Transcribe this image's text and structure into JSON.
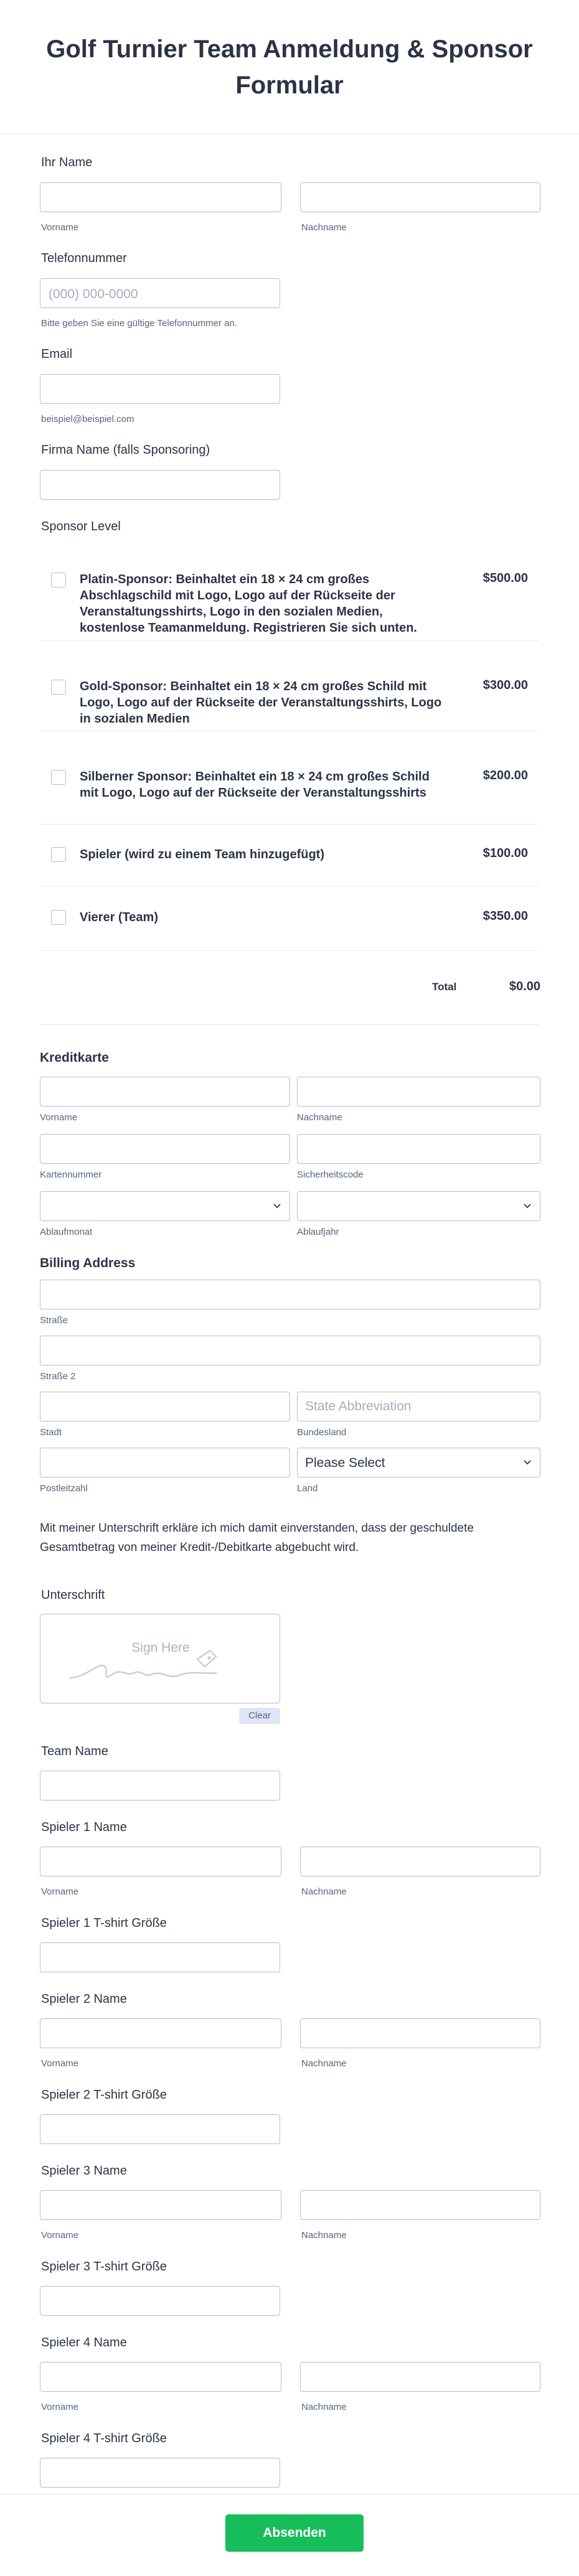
{
  "form": {
    "title": "Golf Turnier Team Anmeldung & Sponsor Formular",
    "name": {
      "label": "Ihr Name",
      "first_sub": "Vorname",
      "last_sub": "Nachname"
    },
    "phone": {
      "label": "Telefonnummer",
      "placeholder": "(000) 000-0000",
      "sub": "Bitte geben Sie eine gültige Telefonnummer an."
    },
    "email": {
      "label": "Email",
      "sub": "beispiel@beispiel.com"
    },
    "company": {
      "label": "Firma Name (falls Sponsoring)"
    },
    "sponsor": {
      "label": "Sponsor Level",
      "items": [
        {
          "text": "Platin-Sponsor: Beinhaltet ein 18 × 24 cm großes Abschlagschild mit Logo, Logo auf der Rückseite der Veranstaltungsshirts, Logo in den sozialen Medien, kostenlose Teamanmeldung. Registrieren Sie sich unten.",
          "price": "$500.00"
        },
        {
          "text": "Gold-Sponsor: Beinhaltet ein 18 × 24 cm großes Schild mit Logo, Logo auf der Rückseite der Veranstaltungsshirts, Logo in sozialen Medien",
          "price": "$300.00"
        },
        {
          "text": "Silberner Sponsor: Beinhaltet ein 18 × 24 cm großes Schild mit Logo, Logo auf der Rückseite der Veranstaltungsshirts",
          "price": "$200.00"
        },
        {
          "text": "Spieler (wird zu einem Team hinzugefügt)",
          "price": "$100.00"
        },
        {
          "text": "Vierer (Team)",
          "price": "$350.00"
        }
      ],
      "total_label": "Total",
      "total_value": "$0.00"
    },
    "card": {
      "label": "Kreditkarte",
      "first_sub": "Vorname",
      "last_sub": "Nachname",
      "number_sub": "Kartennummer",
      "cvv_sub": "Sicherheitscode",
      "month_sub": "Ablaufmonat",
      "year_sub": "Ablaufjahr"
    },
    "billing": {
      "label": "Billing Address",
      "street_sub": "Straße",
      "street2_sub": "Straße 2",
      "city_sub": "Stadt",
      "state_placeholder": "State Abbreviation",
      "state_sub": "Bundesland",
      "zip_sub": "Postleitzahl",
      "country_value": "Please Select",
      "country_sub": "Land"
    },
    "consent": "Mit meiner Unterschrift erkläre ich mich damit einverstanden, dass der geschuldete Gesamtbetrag von meiner Kredit-/Debitkarte abgebucht wird.",
    "signature": {
      "label": "Unterschrift",
      "placeholder": "Sign Here",
      "clear": "Clear"
    },
    "team": {
      "label": "Team Name"
    },
    "players": [
      {
        "name_label": "Spieler 1 Name",
        "shirt_label": "Spieler 1 T-shirt Größe"
      },
      {
        "name_label": "Spieler 2 Name",
        "shirt_label": "Spieler 2 T-shirt Größe"
      },
      {
        "name_label": "Spieler 3 Name",
        "shirt_label": "Spieler 3 T-shirt Größe"
      },
      {
        "name_label": "Spieler 4 Name",
        "shirt_label": "Spieler 4 T-shirt Größe"
      }
    ],
    "player_first_sub": "Vorname",
    "player_last_sub": "Nachname",
    "submit": "Absenden",
    "colors": {
      "submit": "#18bd5b",
      "text": "#2c3345",
      "border": "#b8bdc9"
    }
  }
}
